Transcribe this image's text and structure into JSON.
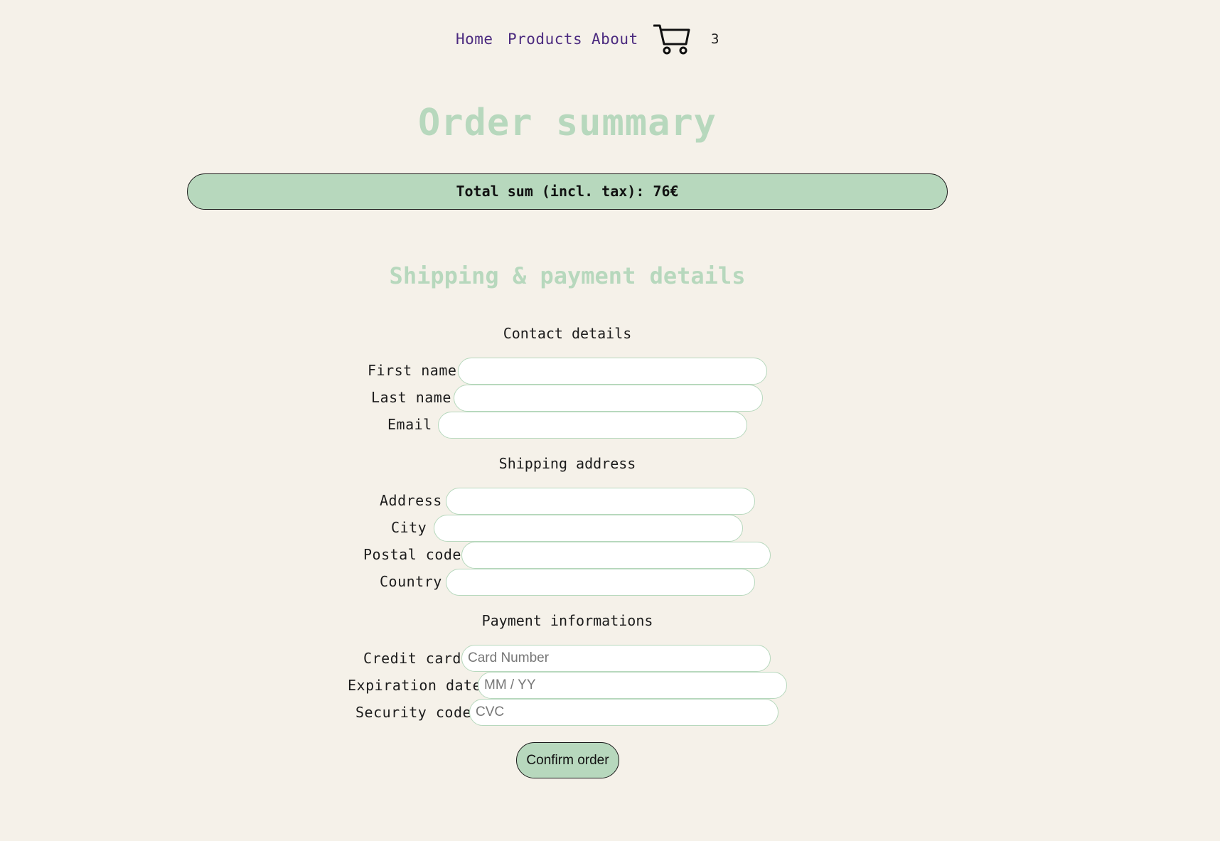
{
  "nav": {
    "links": [
      "Home",
      "Products",
      "About"
    ],
    "cart_icon": "shopping-cart-icon",
    "cart_count": "3"
  },
  "page_title": "Order summary",
  "total_bar": "Total sum (incl. tax): 76€",
  "details_title": "Shipping & payment details",
  "contact": {
    "heading": "Contact details",
    "first_name_label": "First name",
    "last_name_label": "Last name",
    "email_label": "Email"
  },
  "shipping": {
    "heading": "Shipping address",
    "address_label": "Address",
    "city_label": "City",
    "postal_code_label": "Postal code",
    "country_label": "Country"
  },
  "payment": {
    "heading": "Payment informations",
    "credit_card_label": "Credit card",
    "credit_card_placeholder": "Card Number",
    "expiration_label": "Expiration date",
    "expiration_placeholder": "MM / YY",
    "security_label": "Security code",
    "security_placeholder": "CVC"
  },
  "confirm_label": "Confirm order",
  "colors": {
    "background": "#f5f1e9",
    "accent_green": "#b7d8bd",
    "nav_link": "#4b2a7f"
  }
}
